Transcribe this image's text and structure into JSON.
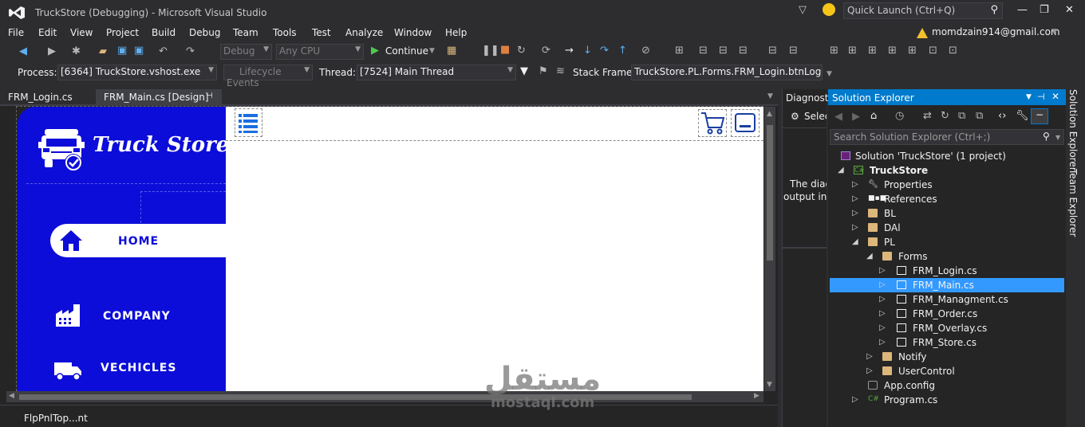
{
  "window": {
    "title": "TruckStore (Debugging) - Microsoft Visual Studio",
    "quick_launch_placeholder": "Quick Launch (Ctrl+Q)",
    "account": "momdzain914@gmail.com"
  },
  "menu": [
    "File",
    "Edit",
    "View",
    "Project",
    "Build",
    "Debug",
    "Team",
    "Tools",
    "Test",
    "Analyze",
    "Window",
    "Help"
  ],
  "toolbar": {
    "config": "Debug",
    "platform": "Any CPU",
    "continue_label": "Continue",
    "process_label": "Process:",
    "process_value": "[6364] TruckStore.vshost.exe",
    "lifecycle_label": "Lifecycle Events",
    "thread_label": "Thread:",
    "thread_value": "[7524] Main Thread",
    "stack_label": "Stack Frame:",
    "stack_value": "TruckStore.PL.Forms.FRM_Login.btnLogir"
  },
  "doc_tabs": [
    "FRM_Login.cs",
    "FRM_Main.cs [Design]"
  ],
  "form": {
    "brand": "Truck Store",
    "nav": {
      "home": "HOME",
      "company": "COMPANY",
      "vehicles": "VECHICLES"
    },
    "tray_item": "FlpPnlTop...nt"
  },
  "diagnostics": {
    "title": "Diagnosti",
    "select": "Selec",
    "message_line1": "The diag",
    "message_line2": "output in t"
  },
  "solution_explorer": {
    "title": "Solution Explorer",
    "search_placeholder": "Search Solution Explorer (Ctrl+;)",
    "solution": "Solution 'TruckStore' (1 project)",
    "project": "TruckStore",
    "items": {
      "properties": "Properties",
      "references": "References",
      "bl": "BL",
      "dal": "DAl",
      "pl": "PL",
      "forms": "Forms",
      "frm_login": "FRM_Login.cs",
      "frm_main": "FRM_Main.cs",
      "frm_managment": "FRM_Managment.cs",
      "frm_order": "FRM_Order.cs",
      "frm_overlay": "FRM_Overlay.cs",
      "frm_store": "FRM_Store.cs",
      "notify": "Notify",
      "usercontrol": "UserControl",
      "app_config": "App.config",
      "program": "Program.cs"
    }
  },
  "side_tabs": [
    "Solution Explorer",
    "Team Explorer"
  ],
  "watermark": {
    "arabic": "مستقل",
    "latin": "mostaql.com"
  },
  "colors": {
    "accent": "#007acc",
    "form_blue": "#0d0dd9",
    "selection": "#3399ff"
  }
}
